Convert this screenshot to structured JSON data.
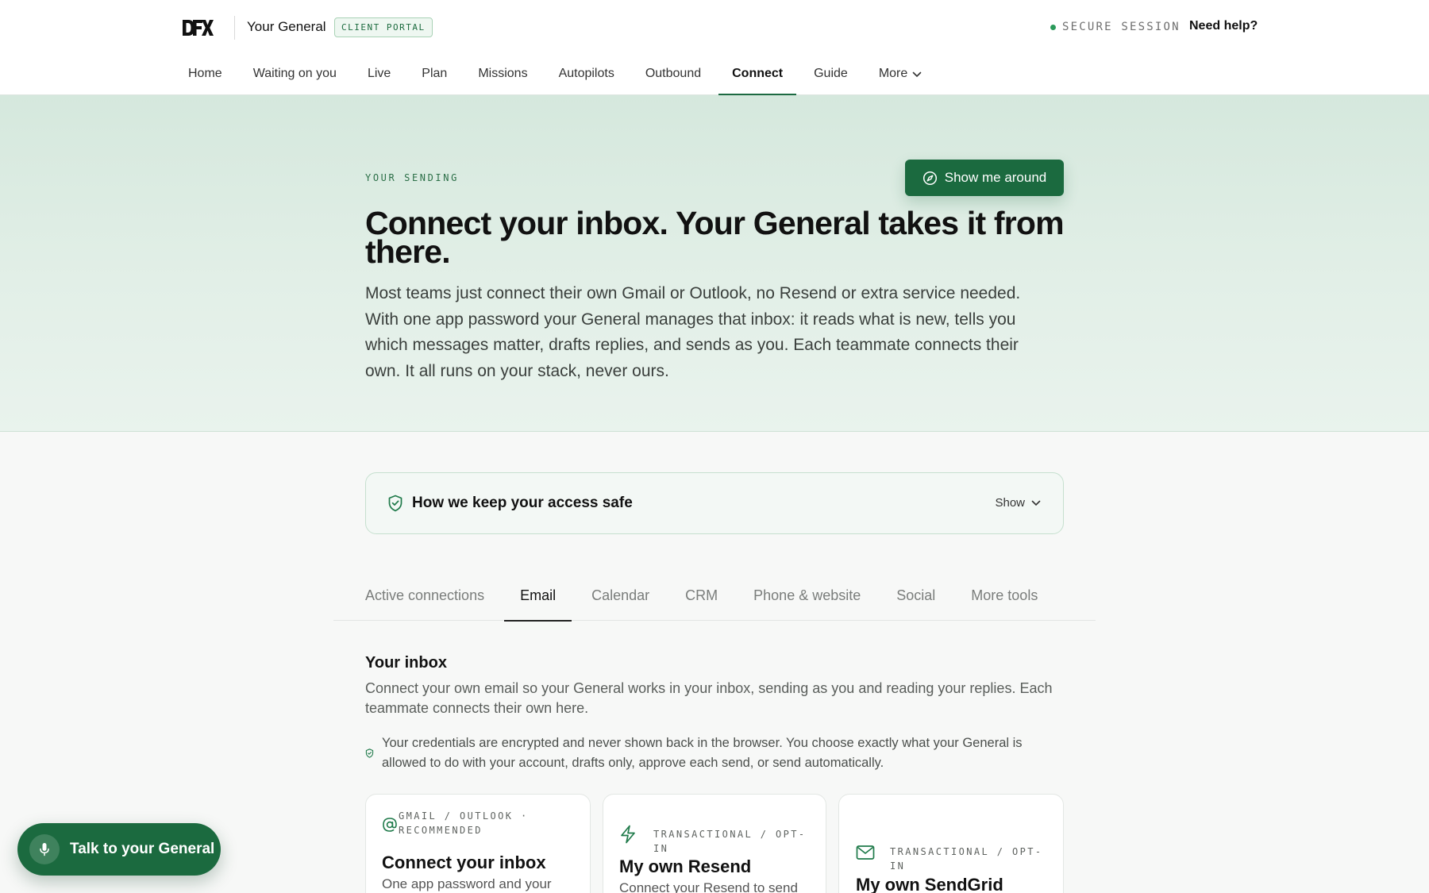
{
  "header": {
    "logo_text": "DFX",
    "brand": "Your General",
    "portal_badge": "CLIENT PORTAL",
    "session_status": "SECURE SESSION",
    "help_link": "Need help?"
  },
  "nav": {
    "items": [
      {
        "label": "Home"
      },
      {
        "label": "Waiting on you"
      },
      {
        "label": "Live"
      },
      {
        "label": "Plan"
      },
      {
        "label": "Missions"
      },
      {
        "label": "Autopilots"
      },
      {
        "label": "Outbound"
      },
      {
        "label": "Connect",
        "active": true
      },
      {
        "label": "Guide"
      }
    ],
    "more_label": "More"
  },
  "hero": {
    "eyebrow": "YOUR SENDING",
    "tour_button": "Show me around",
    "title": "Connect your inbox. Your General takes it from there.",
    "copy": "Most teams just connect their own Gmail or Outlook, no Resend or extra service needed. With one app password your General manages that inbox: it reads what is new, tells you which messages matter, drafts replies, and sends as you. Each teammate connects their own. It all runs on your stack, never ours."
  },
  "safety": {
    "title": "How we keep your access safe",
    "toggle": "Show"
  },
  "tabs": [
    {
      "label": "Active connections"
    },
    {
      "label": "Email",
      "active": true
    },
    {
      "label": "Calendar"
    },
    {
      "label": "CRM"
    },
    {
      "label": "Phone & website"
    },
    {
      "label": "Social"
    },
    {
      "label": "More tools"
    }
  ],
  "inbox": {
    "title": "Your inbox",
    "description": "Connect your own email so your General works in your inbox, sending as you and reading your replies. Each teammate connects their own here.",
    "credentials_note": "Your credentials are encrypted and never shown back in the browser. You choose exactly what your General is allowed to do with your account, drafts only, approve each send, or send automatically."
  },
  "cards": [
    {
      "icon": "at-sign-icon",
      "tag": "GMAIL / OUTLOOK · RECOMMENDED",
      "title": "Connect your inbox",
      "desc": "One app password and your"
    },
    {
      "icon": "lightning-icon",
      "tag": "TRANSACTIONAL / OPT-IN",
      "title": "My own Resend",
      "desc": "Connect your Resend to send"
    },
    {
      "icon": "mail-icon",
      "tag": "TRANSACTIONAL / OPT-IN",
      "title": "My own SendGrid",
      "desc": ""
    }
  ],
  "voice": {
    "label": "Talk to your General"
  },
  "colors": {
    "accent": "#1b6a3f",
    "hero_bg": "#d9ebe0",
    "secure_dot": "#2a9a5a"
  }
}
